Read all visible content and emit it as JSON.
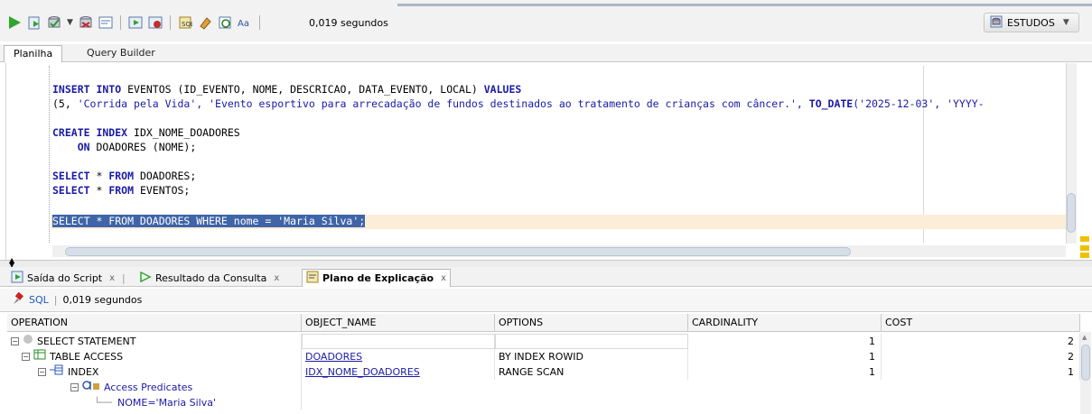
{
  "toolbar": {
    "elapsed": "0,019 segundos",
    "connection": "ESTUDOS"
  },
  "editor_tabs": [
    "Planilha",
    "Query Builder"
  ],
  "code_lines": [
    {
      "parts": [
        {
          "t": "INSERT INTO ",
          "c": "kw"
        },
        {
          "t": "EVENTOS (ID_EVENTO, NOME, DESCRICAO, DATA_EVENTO, LOCAL) ",
          "c": "id"
        },
        {
          "t": "VALUES",
          "c": "kw"
        }
      ]
    },
    {
      "parts": [
        {
          "t": "(5, ",
          "c": "id"
        },
        {
          "t": "'Corrida pela Vida', 'Evento esportivo para arrecadação de fundos destinados ao tratamento de crianças com câncer.', ",
          "c": "str"
        },
        {
          "t": "TO_DATE",
          "c": "kw"
        },
        {
          "t": "('2025-12-03', 'YYYY-",
          "c": "str"
        }
      ]
    },
    {
      "parts": [
        {
          "t": "CREATE INDEX ",
          "c": "kw"
        },
        {
          "t": "IDX_NOME_DOADORES",
          "c": "id"
        }
      ]
    },
    {
      "parts": [
        {
          "t": "    ON ",
          "c": "kw"
        },
        {
          "t": "DOADORES (NOME);",
          "c": "id"
        }
      ]
    },
    {
      "parts": [
        {
          "t": "SELECT ",
          "c": "kw"
        },
        {
          "t": "* ",
          "c": "id"
        },
        {
          "t": "FROM ",
          "c": "kw"
        },
        {
          "t": "DOADORES;",
          "c": "id"
        }
      ]
    },
    {
      "parts": [
        {
          "t": "SELECT ",
          "c": "kw"
        },
        {
          "t": "* ",
          "c": "id"
        },
        {
          "t": "FROM ",
          "c": "kw"
        },
        {
          "t": "EVENTOS;",
          "c": "id"
        }
      ]
    },
    {
      "parts": [
        {
          "t": "SELECT * FROM DOADORES WHERE nome = 'Maria Silva';",
          "c": "sel"
        }
      ]
    }
  ],
  "bottom_tabs": [
    {
      "label": "Saída do Script",
      "active": false
    },
    {
      "label": "Resultado da Consulta",
      "active": false
    },
    {
      "label": "Plano de Explicação",
      "active": true
    }
  ],
  "close_glyph": "x",
  "subbar": {
    "sql": "SQL",
    "elapsed": "0,019 segundos"
  },
  "grid": {
    "columns": [
      "OPERATION",
      "OBJECT_NAME",
      "OPTIONS",
      "CARDINALITY",
      "COST"
    ],
    "rows": [
      {
        "op": "SELECT STATEMENT",
        "object": "",
        "options": "",
        "card": "1",
        "cost": "2"
      },
      {
        "op": "TABLE ACCESS",
        "object": "DOADORES",
        "options": "BY INDEX ROWID",
        "card": "1",
        "cost": "2"
      },
      {
        "op": "INDEX",
        "object": "IDX_NOME_DOADORES",
        "options": "RANGE SCAN",
        "card": "1",
        "cost": "1"
      },
      {
        "op": "Access Predicates",
        "object": "",
        "options": "",
        "card": "",
        "cost": ""
      },
      {
        "op": "NOME='Maria Silva'",
        "object": "",
        "options": "",
        "card": "",
        "cost": ""
      }
    ]
  },
  "colors": {
    "keyword": "#1a1aa6",
    "selection": "#3f64a8",
    "highlight_line": "#fbedd7",
    "link": "#1a1aa6"
  }
}
